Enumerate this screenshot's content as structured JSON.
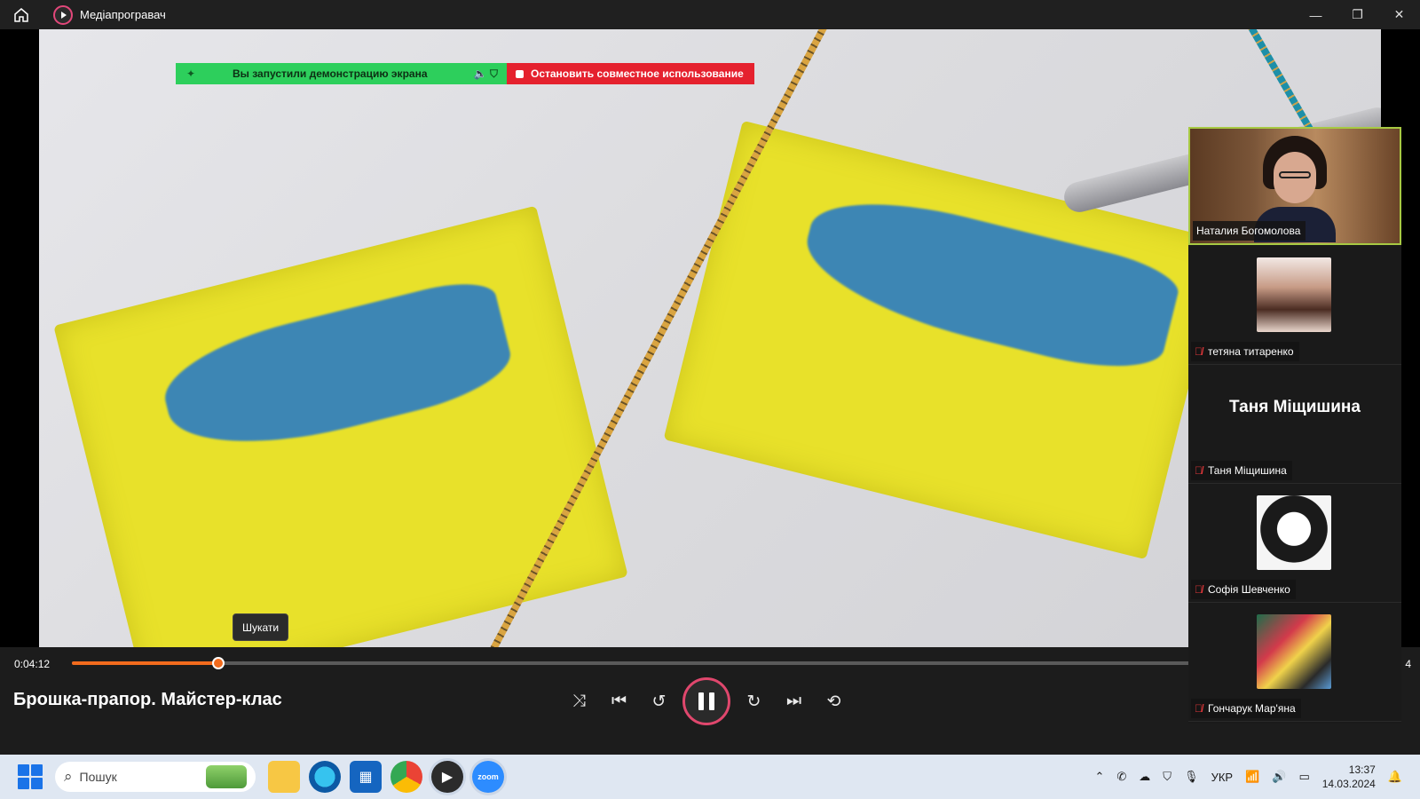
{
  "titlebar": {
    "title": "Медіапрогравач",
    "minimize": "—",
    "maximize": "❐",
    "close": "✕"
  },
  "share_banner": {
    "status": "Вы запустили демонстрацию экрана",
    "stop": "Остановить совместное использование"
  },
  "tooltip": "Шукати",
  "player": {
    "current_time": "0:04:12",
    "end_time": "4",
    "progress_fraction": 0.111,
    "title": "Брошка-прапор. Майстер-клас"
  },
  "participants": [
    {
      "name": "Наталия Богомолова",
      "video": true
    },
    {
      "name": "тетяна титаренко",
      "avatar": "av1"
    },
    {
      "name": "Таня Міщишина",
      "display": "Таня Міщишина"
    },
    {
      "name": "Софія Шевченко",
      "avatar": "av2"
    },
    {
      "name": "Гончарук Мар'яна",
      "avatar": "av3"
    }
  ],
  "taskbar": {
    "search_placeholder": "Пошук",
    "lang": "УКР",
    "time": "13:37",
    "date": "14.03.2024",
    "zoom_label": "zoom"
  },
  "colors": {
    "accent": "#f26b1d",
    "share_green": "#2dcf5c",
    "stop_red": "#e5212e",
    "active_speaker": "#a7c943"
  }
}
